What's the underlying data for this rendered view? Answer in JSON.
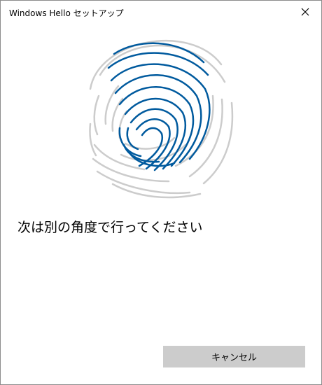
{
  "window": {
    "title": "Windows Hello セットアップ",
    "close_icon": "close-icon"
  },
  "fingerprint": {
    "icon": "fingerprint-icon",
    "captured_color": "#005a9e",
    "pending_color": "#cccccc"
  },
  "main": {
    "instruction": "次は別の角度で行ってください"
  },
  "footer": {
    "cancel_label": "キャンセル"
  }
}
